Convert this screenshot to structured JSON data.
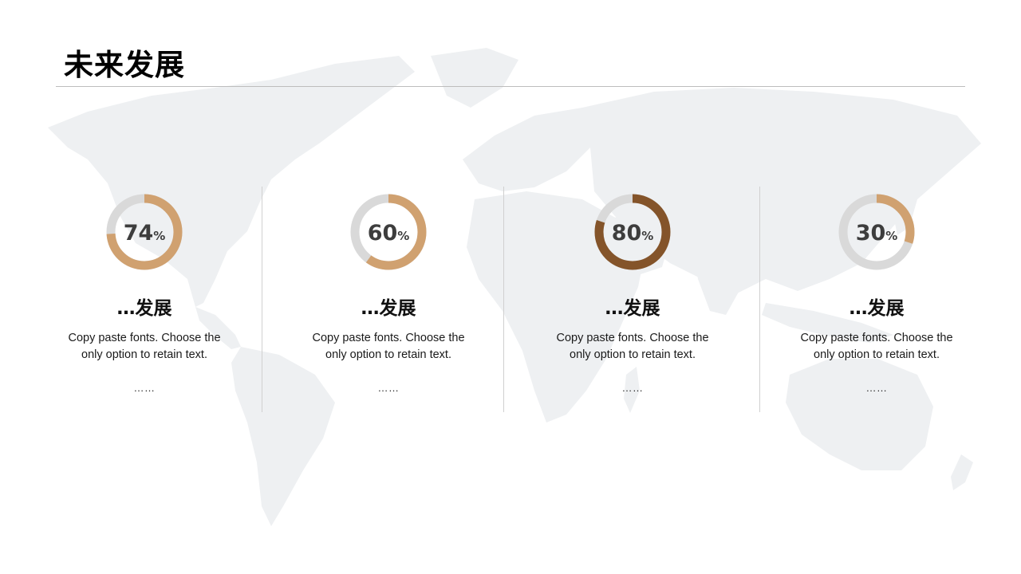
{
  "slide": {
    "title": "未来发展"
  },
  "cards": [
    {
      "value": 74,
      "value_text": "74",
      "unit_text": "%",
      "ring_color": "#D0A170",
      "heading": "…发展",
      "desc_line1": "Copy paste fonts. Choose the",
      "desc_line2": "only option to retain text.",
      "more": "……"
    },
    {
      "value": 60,
      "value_text": "60",
      "unit_text": "%",
      "ring_color": "#D0A170",
      "heading": "…发展",
      "desc_line1": "Copy paste fonts. Choose the",
      "desc_line2": "only option to retain text.",
      "more": "……"
    },
    {
      "value": 80,
      "value_text": "80",
      "unit_text": "%",
      "ring_color": "#84542A",
      "heading": "…发展",
      "desc_line1": "Copy paste fonts. Choose the",
      "desc_line2": "only option to retain text.",
      "more": "……"
    },
    {
      "value": 30,
      "value_text": "30",
      "unit_text": "%",
      "ring_color": "#D0A170",
      "heading": "…发展",
      "desc_line1": "Copy paste fonts. Choose the",
      "desc_line2": "only option to retain text.",
      "more": "……"
    }
  ],
  "colors": {
    "ring_track": "#D9D9D9",
    "map_fill": "#EEF0F2"
  }
}
